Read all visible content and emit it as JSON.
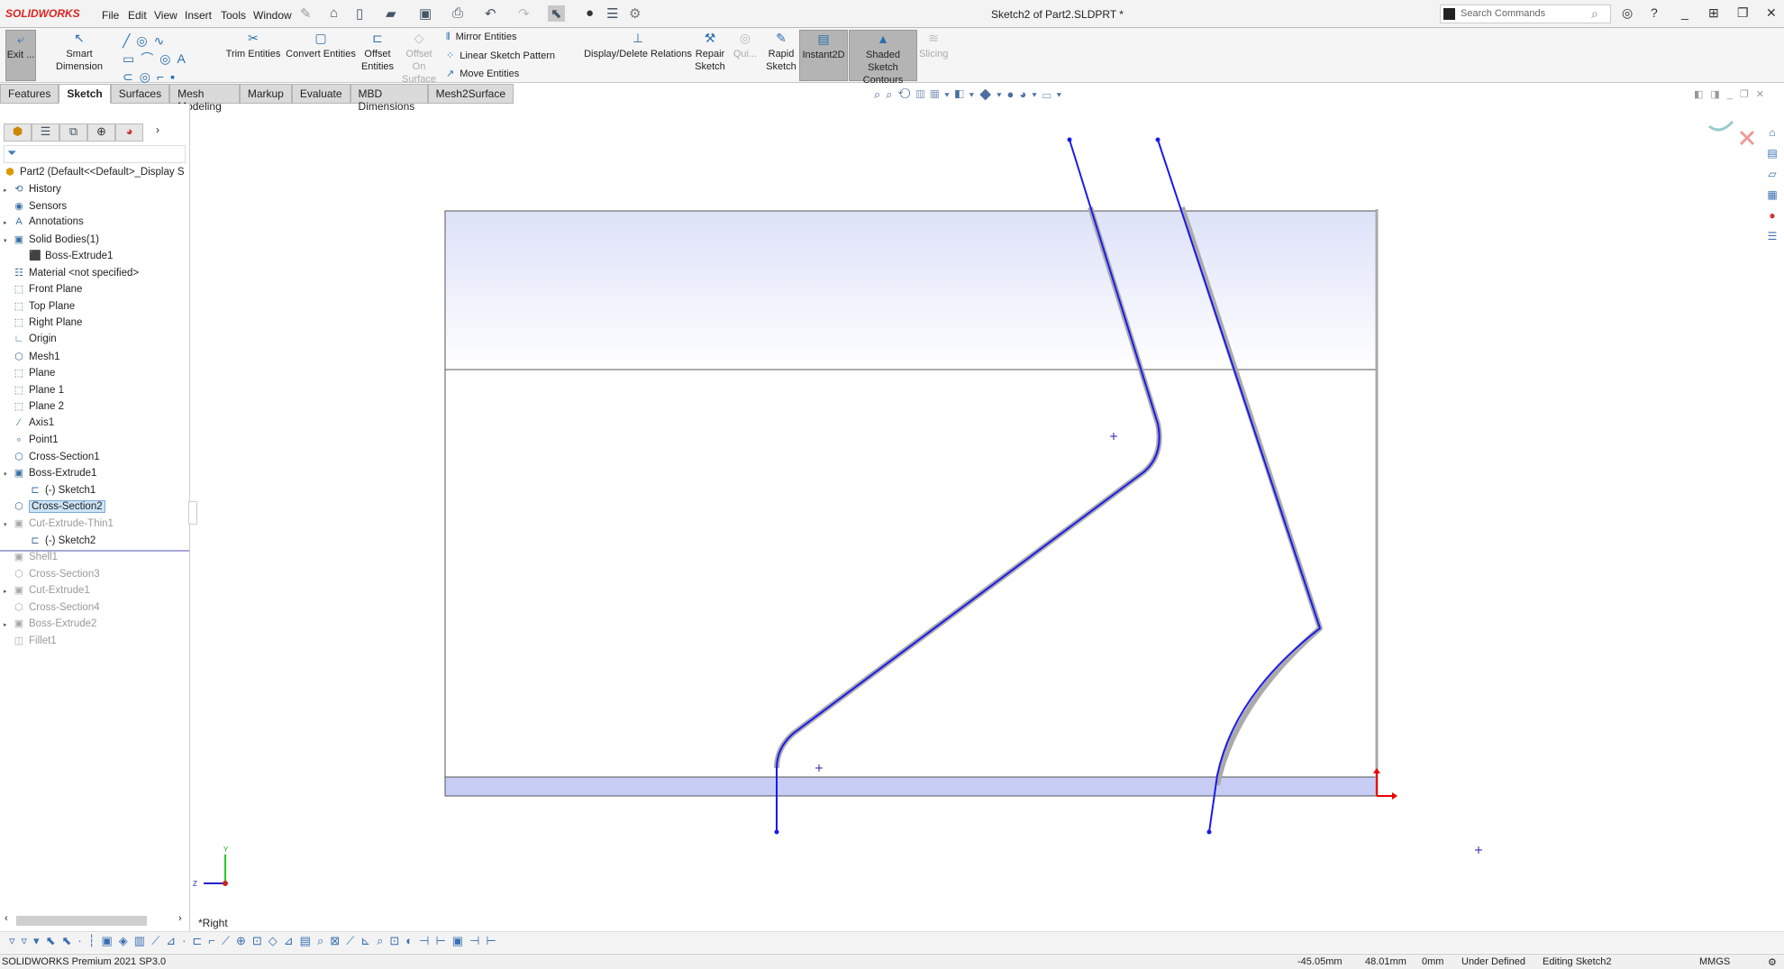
{
  "app": {
    "logo": "SOLIDWORKS",
    "title": "Sketch2 of Part2.SLDPRT *"
  },
  "menu": [
    "File",
    "Edit",
    "View",
    "Insert",
    "Tools",
    "Window"
  ],
  "search": {
    "placeholder": "Search Commands"
  },
  "ribbon": {
    "exit": "Exit ...",
    "smart_dimension": "Smart Dimension",
    "trim": "Trim Entities",
    "convert": "Convert Entities",
    "offset": "Offset Entities",
    "offset_surface": "Offset On Surface",
    "mirror": "Mirror Entities",
    "linear_pattern": "Linear Sketch Pattern",
    "move": "Move Entities",
    "relations": "Display/Delete Relations",
    "repair": "Repair Sketch",
    "quick": "Qui...",
    "rapid": "Rapid Sketch",
    "instant2d": "Instant2D",
    "shaded": "Shaded Sketch Contours",
    "slicing": "Slicing"
  },
  "tabs": [
    "Features",
    "Sketch",
    "Surfaces",
    "Mesh Modeling",
    "Markup",
    "Evaluate",
    "MBD Dimensions",
    "Mesh2Surface"
  ],
  "active_tab": "Sketch",
  "tree": {
    "root": "Part2  (Default<<Default>_Display S",
    "items": [
      {
        "label": "History",
        "icon": "history-icon"
      },
      {
        "label": "Sensors",
        "icon": "sensors-icon"
      },
      {
        "label": "Annotations",
        "icon": "annotations-icon"
      },
      {
        "label": "Solid Bodies(1)",
        "icon": "solid-bodies-icon"
      },
      {
        "label": "Boss-Extrude1",
        "icon": "body-icon"
      },
      {
        "label": "Material <not specified>",
        "icon": "material-icon"
      },
      {
        "label": "Front Plane",
        "icon": "plane-icon"
      },
      {
        "label": "Top Plane",
        "icon": "plane-icon"
      },
      {
        "label": "Right Plane",
        "icon": "plane-icon"
      },
      {
        "label": "Origin",
        "icon": "origin-icon"
      },
      {
        "label": "Mesh1",
        "icon": "mesh-icon"
      },
      {
        "label": "Plane",
        "icon": "plane-icon"
      },
      {
        "label": "Plane 1",
        "icon": "plane-icon"
      },
      {
        "label": "Plane 2",
        "icon": "plane-icon"
      },
      {
        "label": "Axis1",
        "icon": "axis-icon"
      },
      {
        "label": "Point1",
        "icon": "point-icon"
      },
      {
        "label": "Cross-Section1",
        "icon": "cross-section-icon"
      },
      {
        "label": "Boss-Extrude1",
        "icon": "extrude-icon"
      },
      {
        "label": "(-) Sketch1",
        "icon": "sketch-icon"
      },
      {
        "label": "Cross-Section2",
        "icon": "cross-section-icon",
        "selected": true
      },
      {
        "label": "Cut-Extrude-Thin1",
        "icon": "cut-extrude-icon",
        "suppressed": true
      },
      {
        "label": "(-) Sketch2",
        "icon": "sketch-icon"
      },
      {
        "label": "Shell1",
        "icon": "shell-icon",
        "suppressed": true
      },
      {
        "label": "Cross-Section3",
        "icon": "cross-section-icon",
        "suppressed": true
      },
      {
        "label": "Cut-Extrude1",
        "icon": "cut-extrude-icon",
        "suppressed": true
      },
      {
        "label": "Cross-Section4",
        "icon": "cross-section-icon",
        "suppressed": true
      },
      {
        "label": "Boss-Extrude2",
        "icon": "extrude-icon",
        "suppressed": true
      },
      {
        "label": "Fillet1",
        "icon": "fillet-icon",
        "suppressed": true
      }
    ]
  },
  "viewport": {
    "view_name": "*Right",
    "triad": {
      "y": "Y",
      "z": "Z"
    },
    "sketch_color": "#1a1aee",
    "body_color": "#c8cdf5"
  },
  "status": {
    "product": "SOLIDWORKS Premium 2021 SP3.0",
    "x": "-45.05mm",
    "y": "48.01mm",
    "z": "0mm",
    "state": "Under Defined",
    "editing": "Editing Sketch2",
    "units": "MMGS"
  }
}
